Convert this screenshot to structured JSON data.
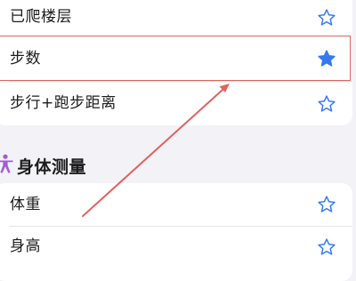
{
  "activity_items": [
    {
      "label": "已爬楼层",
      "favorited": false
    },
    {
      "label": "步数",
      "favorited": true
    },
    {
      "label": "步行+跑步距离",
      "favorited": false
    }
  ],
  "section": {
    "title": "身体测量",
    "icon": "person-figure-icon"
  },
  "body_items": [
    {
      "label": "体重",
      "favorited": false
    },
    {
      "label": "身高",
      "favorited": false
    }
  ],
  "colors": {
    "accent": "#3478f6",
    "section_icon": "#a15cd8",
    "highlight": "#e0625f",
    "background": "#f2f2f7"
  }
}
